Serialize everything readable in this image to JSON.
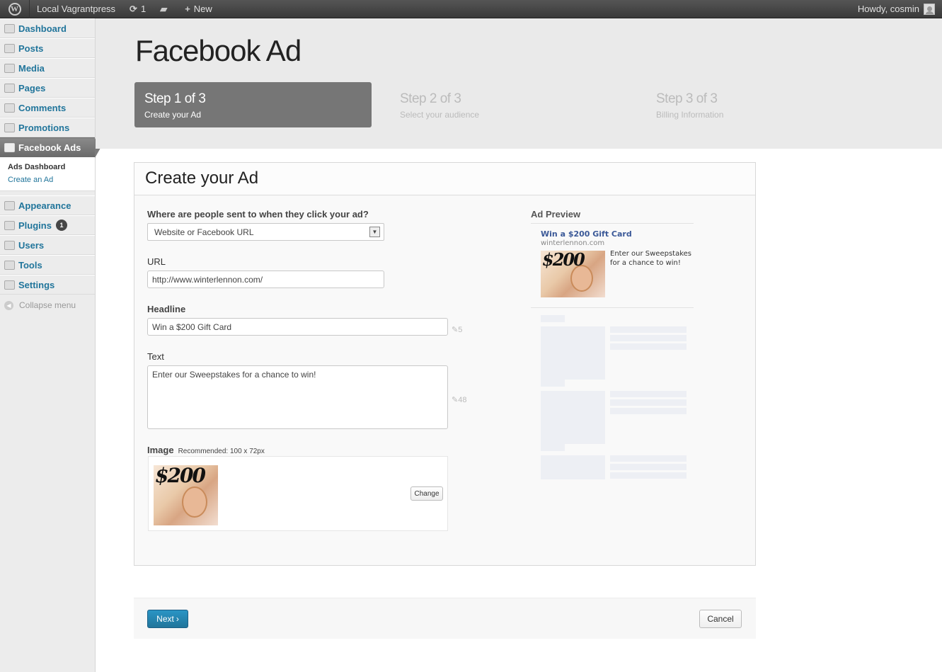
{
  "adminbar": {
    "site_name": "Local Vagrantpress",
    "updates_count": "1",
    "new_label": "New",
    "howdy": "Howdy, cosmin"
  },
  "sidebar": {
    "items": [
      {
        "label": "Dashboard",
        "icon": "dashboard-icon"
      },
      {
        "label": "Posts",
        "icon": "pin-icon"
      },
      {
        "label": "Media",
        "icon": "media-icon"
      },
      {
        "label": "Pages",
        "icon": "pages-icon"
      },
      {
        "label": "Comments",
        "icon": "comment-icon"
      },
      {
        "label": "Promotions",
        "icon": "gear-icon"
      },
      {
        "label": "Facebook Ads",
        "icon": "megaphone-icon"
      }
    ],
    "submenu": [
      "Ads Dashboard",
      "Create an Ad"
    ],
    "items2": [
      {
        "label": "Appearance",
        "icon": "appearance-icon"
      },
      {
        "label": "Plugins",
        "icon": "plugin-icon",
        "badge": "1"
      },
      {
        "label": "Users",
        "icon": "users-icon"
      },
      {
        "label": "Tools",
        "icon": "tools-icon"
      },
      {
        "label": "Settings",
        "icon": "settings-icon"
      }
    ],
    "collapse_label": "Collapse menu"
  },
  "page": {
    "title": "Facebook Ad",
    "steps": [
      {
        "title": "Step 1 of 3",
        "subtitle": "Create your Ad",
        "active": true
      },
      {
        "title": "Step 2 of 3",
        "subtitle": "Select your audience",
        "active": false
      },
      {
        "title": "Step 3 of 3",
        "subtitle": "Billing Information",
        "active": false
      }
    ]
  },
  "form": {
    "card_title": "Create your Ad",
    "destination_label": "Where are people sent to when they click your ad?",
    "destination_value": "Website or Facebook URL",
    "url_label": "URL",
    "url_value": "http://www.winterlennon.com/",
    "headline_label": "Headline",
    "headline_value": "Win a $200 Gift Card",
    "headline_count": "5",
    "text_label": "Text",
    "text_value": "Enter our Sweepstakes for a chance to win!",
    "text_count": "48",
    "image_label": "Image",
    "image_recommended": "Recommended: 100 x 72px",
    "image_text": "$200",
    "change_label": "Change"
  },
  "preview": {
    "label": "Ad Preview",
    "headline": "Win a $200 Gift Card",
    "url": "winterlennon.com",
    "text": "Enter our Sweepstakes for a chance to win!"
  },
  "footer": {
    "next_label": "Next",
    "cancel_label": "Cancel"
  }
}
